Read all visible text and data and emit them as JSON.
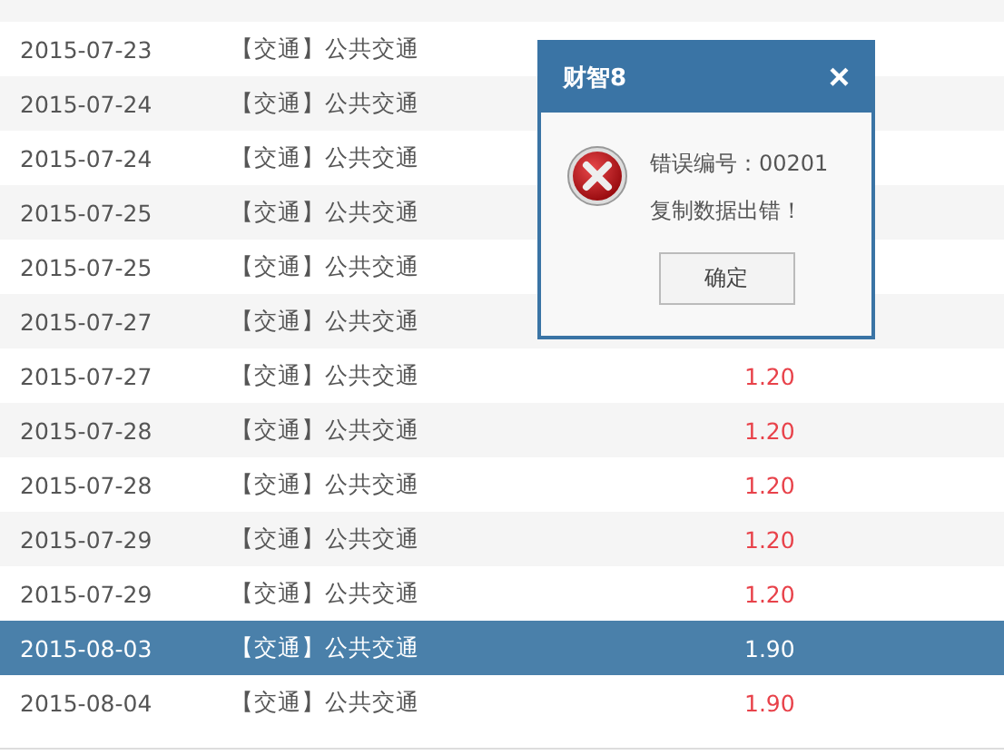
{
  "rows": [
    {
      "date": "2015-07-23",
      "category": "【交通】公共交通",
      "selected": false
    },
    {
      "date": "2015-07-24",
      "category": "【交通】公共交通",
      "selected": false
    },
    {
      "date": "2015-07-24",
      "category": "【交通】公共交通",
      "selected": false
    },
    {
      "date": "2015-07-25",
      "category": "【交通】公共交通",
      "selected": false
    },
    {
      "date": "2015-07-25",
      "category": "【交通】公共交通",
      "selected": false
    },
    {
      "date": "2015-07-27",
      "category": "【交通】公共交通",
      "selected": false
    },
    {
      "date": "2015-07-27",
      "category": "【交通】公共交通",
      "amount": "1.20",
      "selected": false
    },
    {
      "date": "2015-07-28",
      "category": "【交通】公共交通",
      "amount": "1.20",
      "selected": false
    },
    {
      "date": "2015-07-28",
      "category": "【交通】公共交通",
      "amount": "1.20",
      "selected": false
    },
    {
      "date": "2015-07-29",
      "category": "【交通】公共交通",
      "amount": "1.20",
      "selected": false
    },
    {
      "date": "2015-07-29",
      "category": "【交通】公共交通",
      "amount": "1.20",
      "selected": false
    },
    {
      "date": "2015-08-03",
      "category": "【交通】公共交通",
      "amount": "1.90",
      "selected": true
    },
    {
      "date": "2015-08-04",
      "category": "【交通】公共交通",
      "amount": "1.90",
      "selected": false
    }
  ],
  "dialog": {
    "title": "财智8",
    "close": "×",
    "message_lines": [
      "错误编号：00201",
      "复制数据出错！"
    ],
    "button": "确定"
  }
}
